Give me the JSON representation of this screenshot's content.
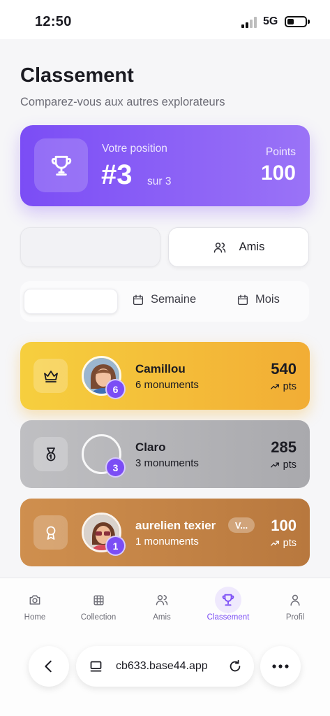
{
  "status_bar": {
    "time": "12:50",
    "network": "5G"
  },
  "header": {
    "title": "Classement",
    "subtitle": "Comparez-vous aux autres explorateurs"
  },
  "position_card": {
    "label": "Votre position",
    "rank": "#3",
    "of": "sur 3",
    "points_label": "Points",
    "points": "100",
    "icon": "trophy-icon"
  },
  "scope_tabs": {
    "left_label": "",
    "right_label": "Amis"
  },
  "period_tabs": {
    "selected_label": "",
    "week": "Semaine",
    "month": "Mois"
  },
  "leaderboard": [
    {
      "rank_icon": "crown-icon",
      "name": "Camillou",
      "monuments": "6 monuments",
      "badge": "6",
      "score": "540",
      "unit": "pts",
      "color": "#f4c23a"
    },
    {
      "rank_icon": "medal-icon",
      "name": "Claro",
      "monuments": "3 monuments",
      "badge": "3",
      "score": "285",
      "unit": "pts",
      "color": "#b5b5b8"
    },
    {
      "rank_icon": "award-icon",
      "name": "aurelien texier",
      "chip": "V...",
      "monuments": "1 monuments",
      "badge": "1",
      "score": "100",
      "unit": "pts",
      "color": "#c48447"
    }
  ],
  "tab_bar": [
    {
      "label": "Home",
      "icon": "camera-icon",
      "active": false
    },
    {
      "label": "Collection",
      "icon": "grid-icon",
      "active": false
    },
    {
      "label": "Amis",
      "icon": "users-icon",
      "active": false
    },
    {
      "label": "Classement",
      "icon": "trophy-icon",
      "active": true
    },
    {
      "label": "Profil",
      "icon": "user-icon",
      "active": false
    }
  ],
  "browser": {
    "url": "cb633.base44.app"
  },
  "colors": {
    "accent": "#7b4df5",
    "gold": "#f4c23a",
    "silver": "#b5b5b8",
    "bronze": "#c48447"
  }
}
